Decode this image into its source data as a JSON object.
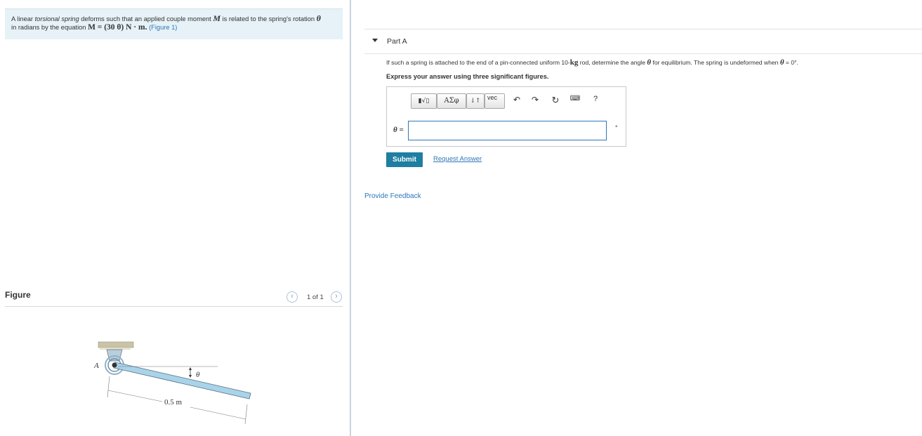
{
  "problem": {
    "text_1": "A linear ",
    "text_2": "torsional spring",
    "text_3": " deforms such that an applied couple moment ",
    "var_M": "M",
    "text_4": " is related to the spring's rotation ",
    "var_theta": "θ",
    "text_5": "in radians by the equation ",
    "equation": "M = (30 θ) N · m.",
    "figure_link": "(Figure 1)"
  },
  "figure": {
    "label": "Figure",
    "pager_text": "1 of 1",
    "prev_icon": "chevron-left-icon",
    "next_icon": "chevron-right-icon",
    "diagram": {
      "point_label": "A",
      "angle_label": "θ",
      "length_label": "0.5 m",
      "colors": {
        "rod": "#a9d3e8",
        "support": "#c9c3a8",
        "spring": "#8fb2c9"
      }
    }
  },
  "part": {
    "title": "Part A",
    "question_1": "If such a spring is attached to the end of a pin-connected uniform 10-",
    "question_unit": "kg",
    "question_2": " rod, determine the angle ",
    "question_theta": "θ",
    "question_3": " for equilibrium. The spring is undeformed when ",
    "question_theta2": "θ",
    "question_4": " = 0°.",
    "instruction": "Express your answer using three significant figures."
  },
  "toolbar": {
    "templates_label": "▮√▯",
    "greek_label": "ΑΣφ",
    "arrows_label": "↓↑",
    "vec_label": "vec",
    "undo_icon": "undo-icon",
    "redo_icon": "redo-icon",
    "reset_icon": "reset-icon",
    "keyboard_icon": "keyboard-icon",
    "help_label": "?"
  },
  "answer": {
    "variable_label": "θ =",
    "value": "",
    "unit": "°"
  },
  "actions": {
    "submit_label": "Submit",
    "request_answer_label": "Request Answer",
    "feedback_label": "Provide Feedback"
  },
  "colors": {
    "accent": "#1f7ea1",
    "link": "#2e77b8",
    "problem_bg": "#e6f2f7"
  }
}
